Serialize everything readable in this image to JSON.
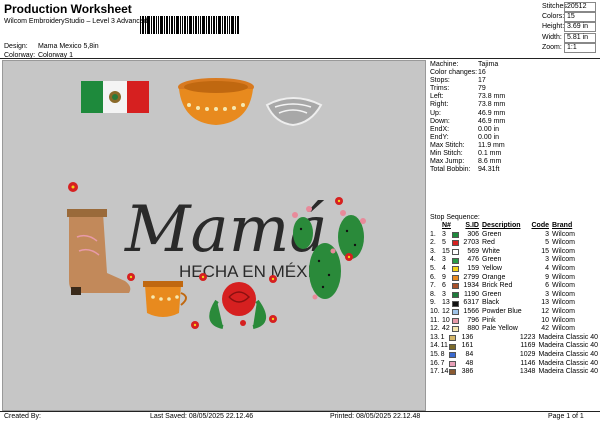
{
  "header": {
    "title": "Production Worksheet",
    "subtitle": "Wilcom EmbroideryStudio – Level 3 Advanced",
    "design_label": "Design:",
    "design_value": "Mama Mexico 5,8in",
    "colorway_label": "Colorway:",
    "colorway_value": "Colorway 1"
  },
  "stats": [
    {
      "label": "Stitches:",
      "value": "20512"
    },
    {
      "label": "Colors:",
      "value": "15"
    },
    {
      "label": "Height:",
      "value": "3.69 in"
    },
    {
      "label": "Width:",
      "value": "5.81 in"
    },
    {
      "label": "Zoom:",
      "value": "1:1"
    }
  ],
  "machine_info": [
    {
      "label": "Machine:",
      "value": "Tajima"
    },
    {
      "label": "Color changes:",
      "value": "16"
    },
    {
      "label": "Stops:",
      "value": "17"
    },
    {
      "label": "Trims:",
      "value": "79"
    },
    {
      "label": "Left:",
      "value": "73.8 mm"
    },
    {
      "label": "Right:",
      "value": "73.8 mm"
    },
    {
      "label": "Up:",
      "value": "46.9 mm"
    },
    {
      "label": "Down:",
      "value": "46.9 mm"
    },
    {
      "label": "EndX:",
      "value": "0.00 in"
    },
    {
      "label": "EndY:",
      "value": "0.00 in"
    },
    {
      "label": "Max Stitch:",
      "value": "11.9 mm"
    },
    {
      "label": "Min Stitch:",
      "value": "0.1 mm"
    },
    {
      "label": "Max Jump:",
      "value": "8.6 mm"
    },
    {
      "label": "Total Bobbin:",
      "value": "94.31ft"
    }
  ],
  "stop_sequence": {
    "title": "Stop Sequence:",
    "headers": {
      "n": "N#",
      "sid": "S.ID",
      "desc": "Description",
      "code": "Code",
      "brand": "Brand"
    },
    "rows": [
      {
        "idx": "1.",
        "n": "3",
        "color": "#1e8a3c",
        "sid": "306",
        "desc": "Green",
        "code": "3",
        "brand": "Wilcom"
      },
      {
        "idx": "2.",
        "n": "5",
        "color": "#d62020",
        "sid": "2703",
        "desc": "Red",
        "code": "5",
        "brand": "Wilcom"
      },
      {
        "idx": "3.",
        "n": "15",
        "color": "#ffffff",
        "sid": "569",
        "desc": "White",
        "code": "15",
        "brand": "Wilcom"
      },
      {
        "idx": "4.",
        "n": "3",
        "color": "#2a9a48",
        "sid": "476",
        "desc": "Green",
        "code": "3",
        "brand": "Wilcom"
      },
      {
        "idx": "5.",
        "n": "4",
        "color": "#f2d21a",
        "sid": "159",
        "desc": "Yellow",
        "code": "4",
        "brand": "Wilcom"
      },
      {
        "idx": "6.",
        "n": "9",
        "color": "#e88a1e",
        "sid": "2799",
        "desc": "Orange",
        "code": "9",
        "brand": "Wilcom"
      },
      {
        "idx": "7.",
        "n": "6",
        "color": "#a8502a",
        "sid": "1934",
        "desc": "Brick Red",
        "code": "6",
        "brand": "Wilcom"
      },
      {
        "idx": "8.",
        "n": "3",
        "color": "#1e7a3a",
        "sid": "1190",
        "desc": "Green",
        "code": "3",
        "brand": "Wilcom"
      },
      {
        "idx": "9.",
        "n": "13",
        "color": "#111111",
        "sid": "6317",
        "desc": "Black",
        "code": "13",
        "brand": "Wilcom"
      },
      {
        "idx": "10.",
        "n": "12",
        "color": "#9fc3e8",
        "sid": "1566",
        "desc": "Powder Blue",
        "code": "12",
        "brand": "Wilcom"
      },
      {
        "idx": "11.",
        "n": "10",
        "color": "#e89aa8",
        "sid": "796",
        "desc": "Pink",
        "code": "10",
        "brand": "Wilcom"
      },
      {
        "idx": "12.",
        "n": "42",
        "color": "#f6e8b0",
        "sid": "880",
        "desc": "Pale Yellow",
        "code": "42",
        "brand": "Wilcom"
      },
      {
        "idx": "13.",
        "n": "1",
        "color": "#d6b86a",
        "sid": "136",
        "desc": "",
        "code": "1223",
        "brand": "Madeira Classic 40"
      },
      {
        "idx": "14.",
        "n": "11",
        "color": "#7a6a2a",
        "sid": "161",
        "desc": "",
        "code": "1169",
        "brand": "Madeira Classic 40"
      },
      {
        "idx": "15.",
        "n": "8",
        "color": "#3a6ad0",
        "sid": "84",
        "desc": "",
        "code": "1029",
        "brand": "Madeira Classic 40"
      },
      {
        "idx": "16.",
        "n": "7",
        "color": "#e8a0b8",
        "sid": "48",
        "desc": "",
        "code": "1146",
        "brand": "Madeira Classic 40"
      },
      {
        "idx": "17.",
        "n": "14",
        "color": "#8a5a32",
        "sid": "386",
        "desc": "",
        "code": "1348",
        "brand": "Madeira Classic 40"
      }
    ]
  },
  "artwork": {
    "line1": "Mamá",
    "line2": "HECHA EN MÉXICO"
  },
  "footer": {
    "created_by": "Created By:",
    "last_saved": "Last Saved: 08/05/2025 22.12.46",
    "printed": "Printed: 08/05/2025 22.12.48",
    "page": "Page 1 of 1"
  }
}
